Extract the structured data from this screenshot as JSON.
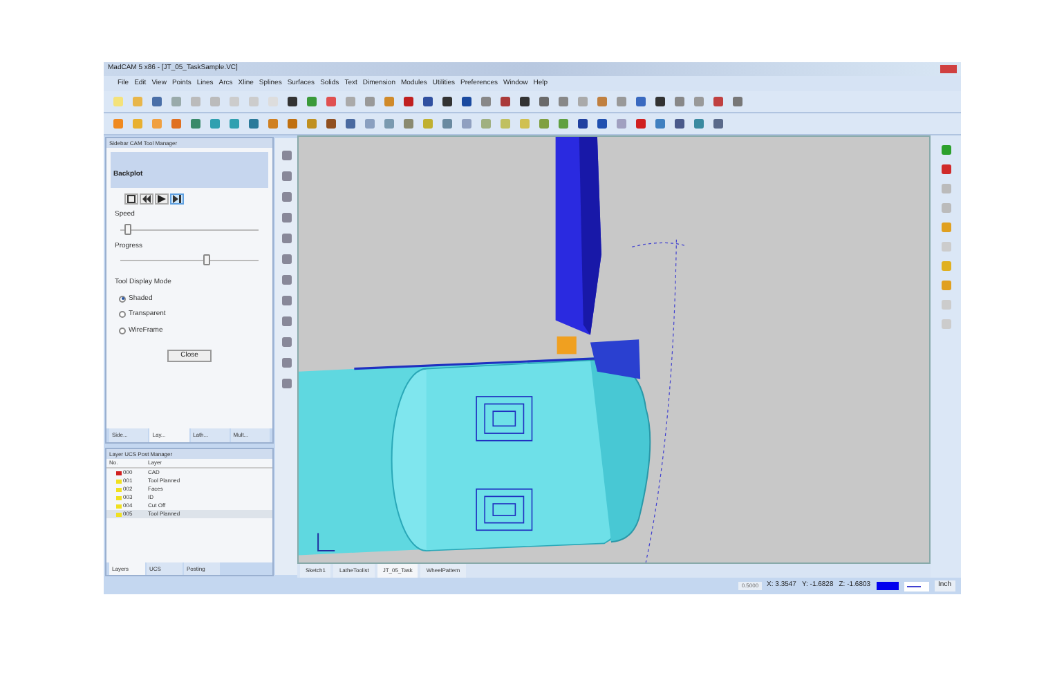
{
  "window": {
    "title": "MadCAM 5 x86 - [JT_05_TaskSample.VC]"
  },
  "menu": [
    "File",
    "Edit",
    "View",
    "Points",
    "Lines",
    "Arcs",
    "Xline",
    "Splines",
    "Surfaces",
    "Solids",
    "Text",
    "Dimension",
    "Modules",
    "Utilities",
    "Preferences",
    "Window",
    "Help"
  ],
  "backplot": {
    "panel_title": "Sidebar CAM Tool Manager",
    "heading": "Backplot",
    "playback": [
      {
        "kind": "stop",
        "selected": false
      },
      {
        "kind": "rewind",
        "selected": false
      },
      {
        "kind": "play",
        "selected": false
      },
      {
        "kind": "step",
        "selected": true
      }
    ],
    "speed": {
      "label": "Speed",
      "level": 0.05
    },
    "progress": {
      "label": "Progress",
      "level": 0.62
    },
    "display_mode": {
      "label": "Tool Display Mode",
      "options": [
        {
          "label": "Shaded",
          "selected": true
        },
        {
          "label": "Transparent",
          "selected": false
        },
        {
          "label": "WireFrame",
          "selected": false
        }
      ]
    },
    "close": "Close",
    "tabs": [
      {
        "label": "Side...",
        "selected": false
      },
      {
        "label": "Lay...",
        "selected": true
      },
      {
        "label": "Lath...",
        "selected": false
      },
      {
        "label": "Mult...",
        "selected": false
      }
    ]
  },
  "layers": {
    "title": "Layer UCS Post Manager",
    "columns": [
      "No.",
      "Layer"
    ],
    "rows": [
      {
        "number": "000",
        "name": "CAD",
        "active": true,
        "selected": false
      },
      {
        "number": "001",
        "name": "Tool Planned",
        "active": false,
        "selected": false
      },
      {
        "number": "002",
        "name": "Faces",
        "active": false,
        "selected": false
      },
      {
        "number": "003",
        "name": "ID",
        "active": false,
        "selected": false
      },
      {
        "number": "004",
        "name": "Cut Off",
        "active": false,
        "selected": false
      },
      {
        "number": "005",
        "name": "Tool Planned",
        "active": false,
        "selected": true
      }
    ],
    "tabs": [
      {
        "label": "Layers",
        "selected": true
      },
      {
        "label": "UCS",
        "selected": false
      },
      {
        "label": "Posting",
        "selected": false
      }
    ]
  },
  "viewport_tabs": [
    {
      "label": "Sketch1",
      "selected": false
    },
    {
      "label": "LatheToolist",
      "selected": false
    },
    {
      "label": "JT_05_Task",
      "selected": true
    },
    {
      "label": "WheelPattern",
      "selected": false
    }
  ],
  "status_bar": {
    "scale": "0.5000",
    "x": "X: 3.3547",
    "y": "Y: -1.6828",
    "z": "Z: -1.6803",
    "color": "#0000ee",
    "unit": "Inch"
  }
}
